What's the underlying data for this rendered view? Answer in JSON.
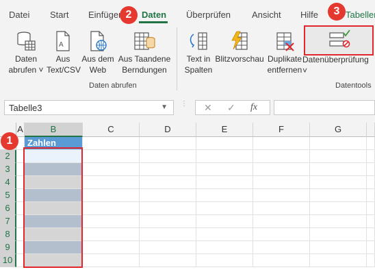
{
  "tabs": [
    {
      "label": "Datei",
      "active": false
    },
    {
      "label": "Start",
      "active": false
    },
    {
      "label": "Einfügen",
      "active": false
    },
    {
      "label": "Daten",
      "active": true
    },
    {
      "label": "Überprüfen",
      "active": false
    },
    {
      "label": "Ansicht",
      "active": false
    },
    {
      "label": "Hilfe",
      "active": false
    },
    {
      "label": "Tabellene",
      "active": false
    }
  ],
  "ribbon": {
    "get_data": {
      "line1": "Daten",
      "line2": "abrufen ˅"
    },
    "from_text_csv": {
      "line1": "Aus",
      "line2": "Text/CSV"
    },
    "from_web": {
      "line1": "Aus dem",
      "line2": "Web"
    },
    "from_table_range": {
      "line1": "Aus Taandene",
      "line2": "Berndungen"
    },
    "group_get_data": "Daten abrufen",
    "text_to_columns": {
      "line1": "Text in",
      "line2": "Spalten"
    },
    "flash_fill": {
      "line1": "Blitzvorschau"
    },
    "remove_duplicates": {
      "line1": "Duplikate",
      "line2": "entfernen"
    },
    "data_validation": {
      "line1": "Datenüberprüfung ˅"
    },
    "group_data_tools": "Datentools"
  },
  "badges": [
    "1",
    "2",
    "3"
  ],
  "formula_bar": {
    "name_box": "Tabelle3",
    "cancel_symbol": "✕",
    "enter_symbol": "✓",
    "fx_symbol": "fx",
    "formula": ""
  },
  "grid": {
    "columns": [
      "A",
      "B",
      "C",
      "D",
      "E",
      "F",
      "G"
    ],
    "rows": [
      "1",
      "2",
      "3",
      "4",
      "5",
      "6",
      "7",
      "8",
      "9",
      "10"
    ],
    "table_header": "Zahlen"
  },
  "colors": {
    "accent": "#217346",
    "highlight": "#e0262c",
    "table_header": "#5b9bd5"
  }
}
